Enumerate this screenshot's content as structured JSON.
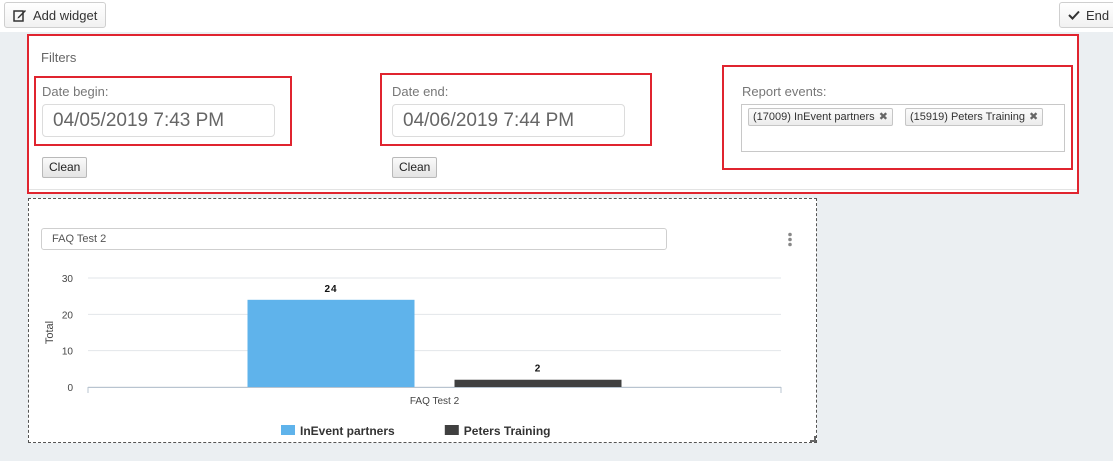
{
  "toolbar": {
    "add_widget_label": "Add widget",
    "end_label": "End"
  },
  "filters": {
    "title": "Filters",
    "date_begin": {
      "label": "Date begin:",
      "value": "04/05/2019 7:43 PM",
      "clean_label": "Clean"
    },
    "date_end": {
      "label": "Date end:",
      "value": "04/06/2019 7:44 PM",
      "clean_label": "Clean"
    },
    "report_events": {
      "label": "Report events:",
      "tags": [
        {
          "text": "(17009) InEvent partners"
        },
        {
          "text": "(15919) Peters Training"
        }
      ],
      "remove_glyph": "✖"
    }
  },
  "widget": {
    "title_value": "FAQ Test 2"
  },
  "colors": {
    "highlight_red": "#e0242f",
    "series_1": "#5fb3eb",
    "series_2": "#404040"
  },
  "chart_data": {
    "type": "bar",
    "categories": [
      "FAQ Test 2"
    ],
    "series": [
      {
        "name": "InEvent partners",
        "values": [
          24
        ],
        "color": "#5fb3eb"
      },
      {
        "name": "Peters Training",
        "values": [
          2
        ],
        "color": "#404040"
      }
    ],
    "title": "",
    "xlabel": "",
    "ylabel": "Total",
    "ylim": [
      0,
      30
    ],
    "yticks": [
      0,
      10,
      20,
      30
    ],
    "grid": true,
    "legend": "bottom",
    "data_labels": true
  }
}
